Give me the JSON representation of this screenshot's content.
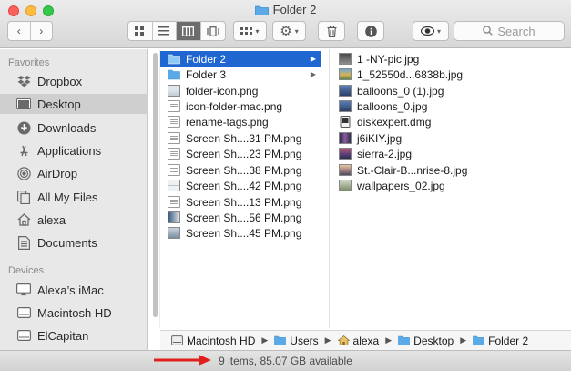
{
  "window": {
    "title": "Folder 2"
  },
  "toolbar": {
    "back_icon": "chevron-left-icon",
    "forward_icon": "chevron-right-icon",
    "view_modes": [
      "icon-view",
      "list-view",
      "column-view",
      "cover-flow-view"
    ],
    "active_view": "column-view",
    "search_placeholder": "Search"
  },
  "sidebar": {
    "favorites_header": "Favorites",
    "favorites": [
      {
        "label": "Dropbox",
        "icon": "dropbox-icon"
      },
      {
        "label": "Desktop",
        "icon": "desktop-icon",
        "selected": true
      },
      {
        "label": "Downloads",
        "icon": "downloads-icon"
      },
      {
        "label": "Applications",
        "icon": "applications-icon"
      },
      {
        "label": "AirDrop",
        "icon": "airdrop-icon"
      },
      {
        "label": "All My Files",
        "icon": "all-files-icon"
      },
      {
        "label": "alexa",
        "icon": "home-icon"
      },
      {
        "label": "Documents",
        "icon": "documents-icon"
      }
    ],
    "devices_header": "Devices",
    "devices": [
      {
        "label": "Alexa’s iMac",
        "icon": "imac-icon"
      },
      {
        "label": "Macintosh HD",
        "icon": "disk-icon"
      },
      {
        "label": "ElCapitan",
        "icon": "disk-icon"
      }
    ]
  },
  "column1": [
    {
      "label": "Folder 2",
      "type": "folder",
      "selected": true
    },
    {
      "label": "Folder 3",
      "type": "folder"
    },
    {
      "label": "folder-icon.png",
      "type": "image"
    },
    {
      "label": "icon-folder-mac.png",
      "type": "doc"
    },
    {
      "label": "rename-tags.png",
      "type": "doc"
    },
    {
      "label": "Screen Sh....31 PM.png",
      "type": "doc"
    },
    {
      "label": "Screen Sh....23 PM.png",
      "type": "doc"
    },
    {
      "label": "Screen Sh....38 PM.png",
      "type": "doc"
    },
    {
      "label": "Screen Sh....42 PM.png",
      "type": "image"
    },
    {
      "label": "Screen Sh....13 PM.png",
      "type": "doc"
    },
    {
      "label": "Screen Sh....56 PM.png",
      "type": "image"
    },
    {
      "label": "Screen Sh....45 PM.png",
      "type": "image"
    }
  ],
  "column2": [
    {
      "label": "1 -NY-pic.jpg",
      "type": "image"
    },
    {
      "label": "1_52550d...6838b.jpg",
      "type": "image"
    },
    {
      "label": "balloons_0 (1).jpg",
      "type": "image"
    },
    {
      "label": "balloons_0.jpg",
      "type": "image"
    },
    {
      "label": "diskexpert.dmg",
      "type": "dmg"
    },
    {
      "label": "j6iKIY.jpg",
      "type": "image"
    },
    {
      "label": "sierra-2.jpg",
      "type": "image"
    },
    {
      "label": "St.-Clair-B...nrise-8.jpg",
      "type": "image"
    },
    {
      "label": "wallpapers_02.jpg",
      "type": "image"
    }
  ],
  "pathbar": [
    {
      "label": "Macintosh HD",
      "icon": "disk-icon"
    },
    {
      "label": "Users",
      "icon": "folder-icon"
    },
    {
      "label": "alexa",
      "icon": "home-icon"
    },
    {
      "label": "Desktop",
      "icon": "folder-icon"
    },
    {
      "label": "Folder 2",
      "icon": "folder-icon"
    }
  ],
  "status": {
    "text": "9 items, 85.07 GB available"
  },
  "colors": {
    "selection": "#1f66d1",
    "folder": "#5aaae8",
    "annotation_arrow": "#e0201c"
  }
}
